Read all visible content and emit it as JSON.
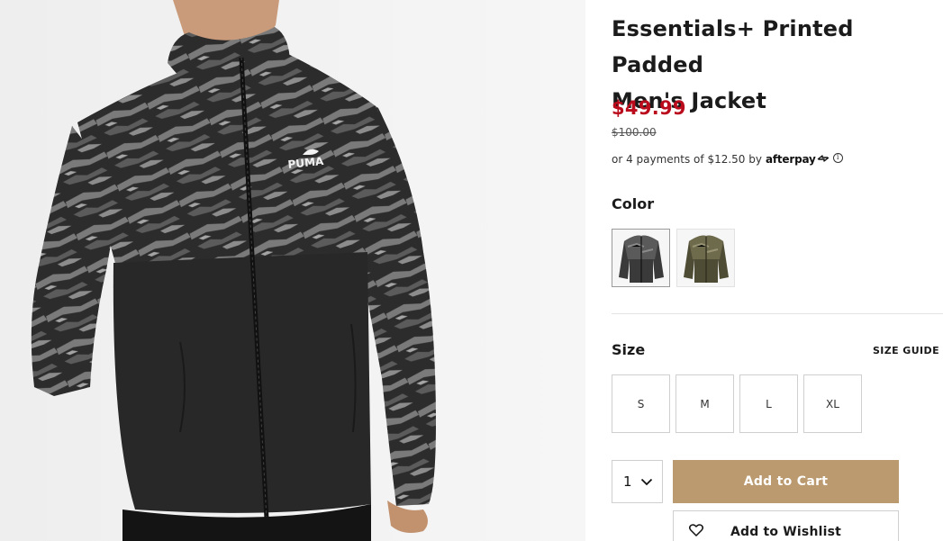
{
  "product": {
    "title_line1": "Essentials+ Printed Padded",
    "title_line2": "Men's Jacket",
    "sale_price": "$49.99",
    "original_price": "$100.00",
    "image_icon": "product-photo-puffer-jacket",
    "brand_print": "PUMA"
  },
  "afterpay": {
    "text": "or 4 payments of $12.50 by",
    "logo": "afterpay",
    "info_symbol": "i"
  },
  "color": {
    "label": "Color",
    "options": [
      {
        "icon": "black-camo-jacket-thumbnail",
        "selected": true,
        "fill": "#3a3a3a"
      },
      {
        "icon": "olive-camo-jacket-thumbnail",
        "selected": false,
        "fill": "#5d5a40"
      }
    ]
  },
  "size": {
    "label": "Size",
    "guide_label": "SIZE GUIDE",
    "options": [
      "S",
      "M",
      "L",
      "XL"
    ]
  },
  "cart": {
    "quantity": "1",
    "add_label": "Add to Cart",
    "wishlist_label": "Add to Wishlist"
  },
  "colors": {
    "sale_red": "#ba0c1c",
    "button_tan": "#ba9a6e",
    "text_dark": "#1b1b1b"
  }
}
